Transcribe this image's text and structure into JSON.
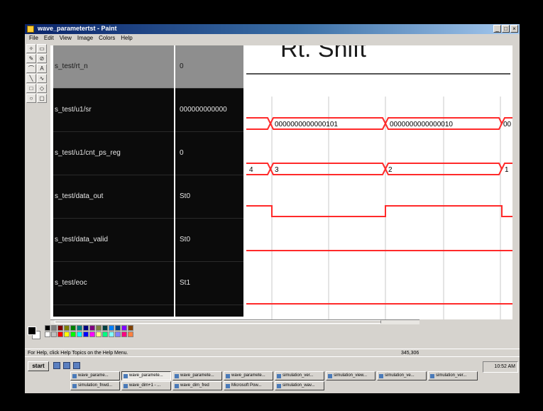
{
  "window": {
    "title": "wave_parametertst - Paint",
    "controls": [
      "_",
      "□",
      "×"
    ]
  },
  "menu": [
    "File",
    "Edit",
    "View",
    "Image",
    "Colors",
    "Help"
  ],
  "tools": [
    "✧",
    "▭",
    "✎",
    "⊘",
    "⌒",
    "A",
    "╲",
    "∿",
    "□",
    "◇",
    "○",
    "▢"
  ],
  "slide_title": "Rt. Shift",
  "signals": [
    {
      "name": "s_test/rt_n",
      "value": "0",
      "selected": true
    },
    {
      "name": "s_test/u1/sr",
      "value": "000000000000"
    },
    {
      "name": "s_test/u1/cnt_ps_reg",
      "value": "0"
    },
    {
      "name": "s_test/data_out",
      "value": "St0"
    },
    {
      "name": "s_test/data_valid",
      "value": "St0"
    },
    {
      "name": "s_test/eoc",
      "value": "St1"
    }
  ],
  "waves": {
    "sr_values": [
      "0000000000000101",
      "0000000000000010",
      "00"
    ],
    "cnt_values": [
      "4",
      "3",
      "2",
      "1"
    ],
    "data_out_levels": [
      1,
      0,
      1,
      0
    ],
    "data_valid_level": 0,
    "eoc_level": 1
  },
  "colors": {
    "wave": "#ff2a2a",
    "names_bg": "#0b0b0b",
    "grid": "#c8c8c8",
    "palette": [
      "#000000",
      "#808080",
      "#800000",
      "#808000",
      "#008000",
      "#008080",
      "#000080",
      "#800080",
      "#808040",
      "#004040",
      "#0080ff",
      "#004080",
      "#8000ff",
      "#804000",
      "#ffffff",
      "#c0c0c0",
      "#ff0000",
      "#ffff00",
      "#00ff00",
      "#00ffff",
      "#0000ff",
      "#ff00ff",
      "#ffff80",
      "#00ff80",
      "#80ffff",
      "#8080ff",
      "#ff0080",
      "#ff8040"
    ]
  },
  "status": {
    "help": "For Help, click Help Topics on the Help Menu.",
    "coords": "345,306"
  },
  "taskbar": {
    "start": "start",
    "tasks_row1": [
      "wave_parame...",
      "wave_paramete...",
      "wave_paramete...",
      "wave_paramete...",
      "simulation_ver...",
      "simulation_view...",
      "simulation_ve...",
      "simulation_ver..."
    ],
    "tasks_row2": [
      "simulation_fnwd...",
      "wave_dim+1 - ...",
      "wave_dim_fred",
      "Microsoft Pow...",
      "simulation_wav..."
    ],
    "clock": "10:52 AM"
  }
}
